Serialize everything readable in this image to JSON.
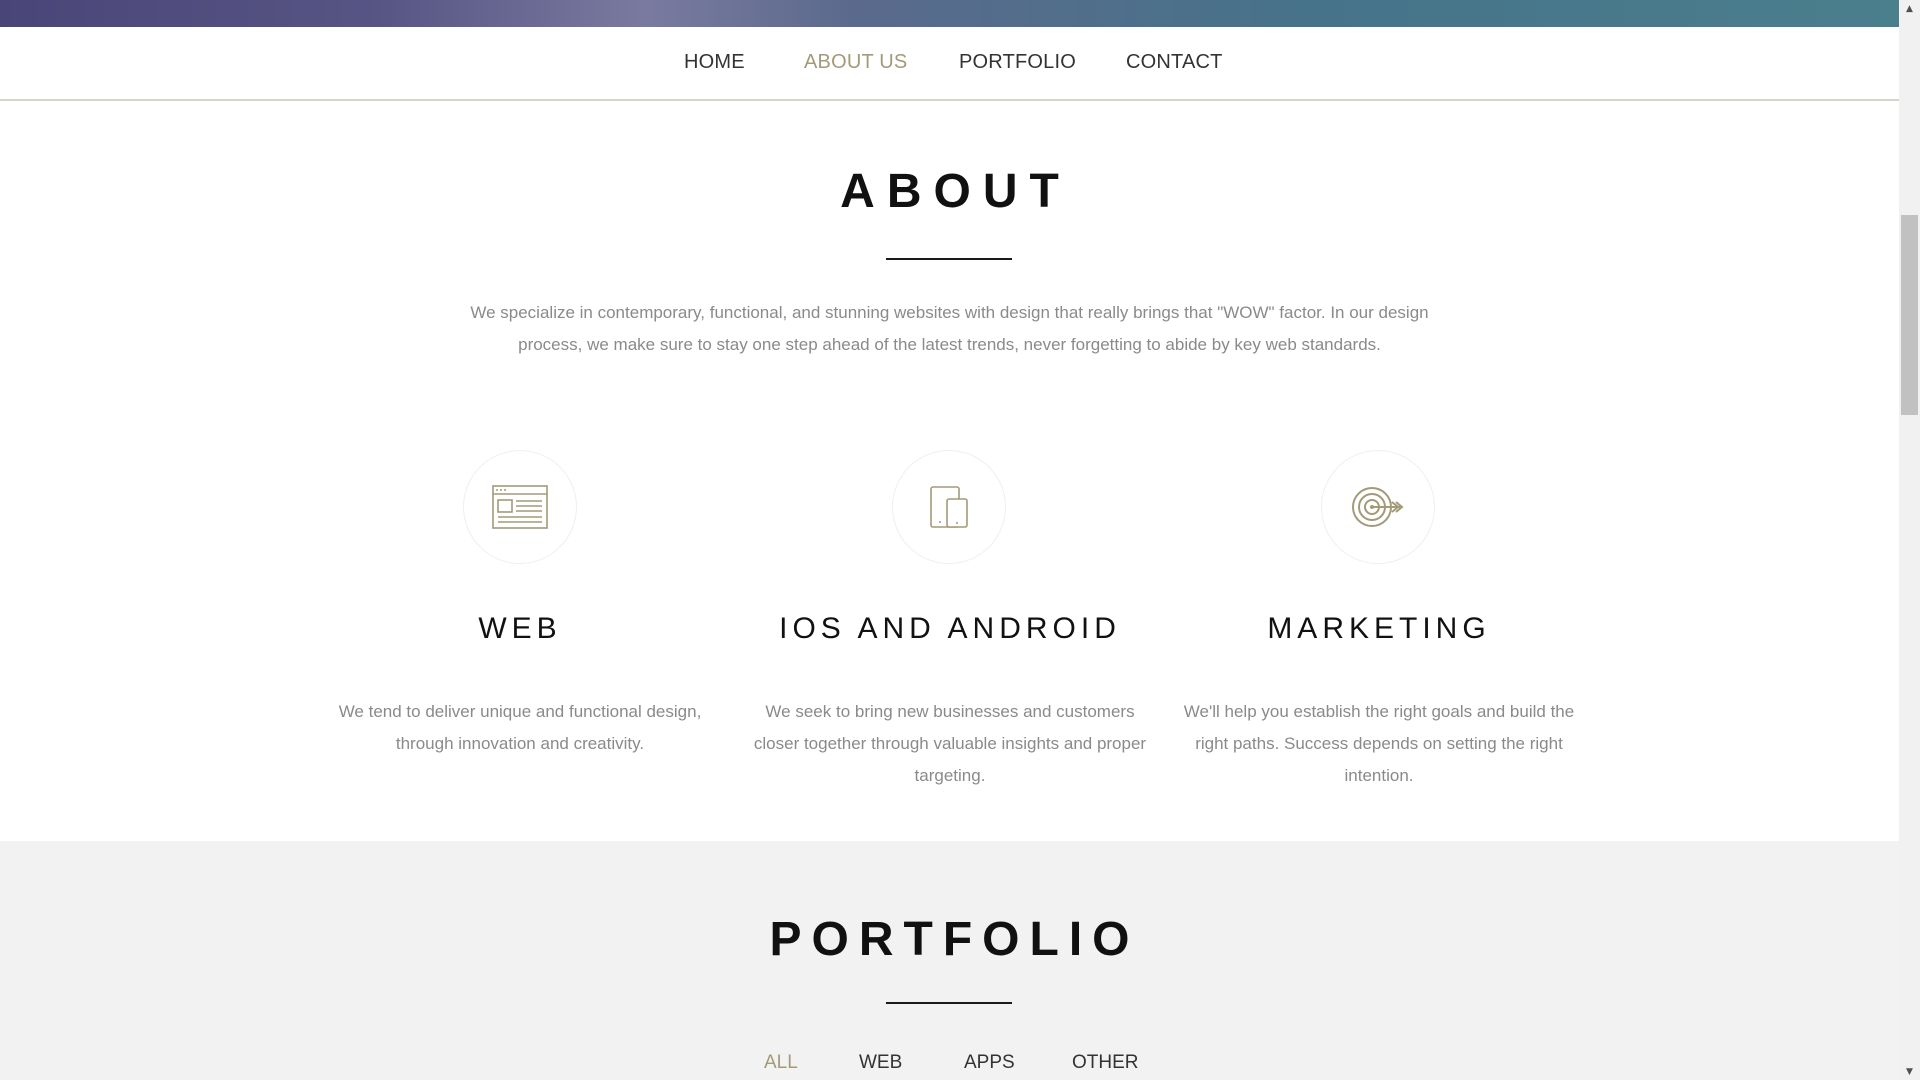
{
  "nav": {
    "items": [
      {
        "label": "HOME",
        "active": false
      },
      {
        "label": "ABOUT US",
        "active": true
      },
      {
        "label": "PORTFOLIO",
        "active": false
      },
      {
        "label": "CONTACT",
        "active": false
      }
    ]
  },
  "about": {
    "title": "ABOUT",
    "description_line1": "We specialize in contemporary, functional, and stunning websites with design that really brings that \"WOW\" factor. In our design",
    "description_line2": "process, we make sure to stay one step ahead of the latest trends, never forgetting to abide by key web standards.",
    "services": [
      {
        "icon": "browser-window-icon",
        "title": "WEB",
        "desc_lines": [
          "We tend to deliver unique and functional design,",
          "through innovation and creativity."
        ]
      },
      {
        "icon": "mobile-devices-icon",
        "title": "IOS AND ANDROID",
        "desc_lines": [
          "We seek to bring new businesses and customers",
          "closer together through valuable insights and proper",
          "targeting."
        ]
      },
      {
        "icon": "target-icon",
        "title": "MARKETING",
        "desc_lines": [
          "We'll help you establish the right goals and build the",
          "right paths. Success depends on setting the right",
          "intention."
        ]
      }
    ]
  },
  "portfolio": {
    "title": "PORTFOLIO",
    "filters": [
      {
        "label": "ALL",
        "active": true
      },
      {
        "label": "WEB",
        "active": false
      },
      {
        "label": "APPS",
        "active": false
      },
      {
        "label": "OTHER",
        "active": false
      }
    ]
  },
  "colors": {
    "accent": "#a39a78",
    "text_dark": "#111111",
    "text_muted": "#8a8a8a",
    "section_gray": "#f2f2f2"
  }
}
